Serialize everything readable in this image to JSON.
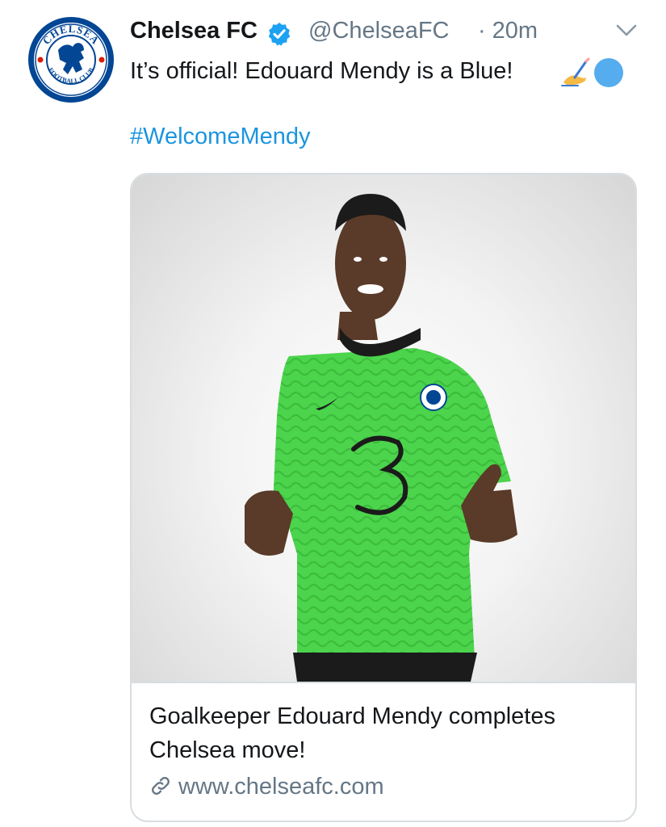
{
  "author": {
    "name": "Chelsea FC",
    "handle": "@ChelseaFC",
    "time": "20m",
    "time_separator": "·",
    "verified": true,
    "avatar_icon": "chelsea-crest-icon",
    "avatar_logo_text": "CHELSEA FOOTBALL CLUB"
  },
  "tweet": {
    "text": "It’s official! Edouard Mendy is a Blue!",
    "emojis": [
      "writing-hand-emoji",
      "blue-circle-emoji"
    ],
    "hashtag": "#WelcomeMendy"
  },
  "card": {
    "image_icon": "player-photo-image",
    "title": "Goalkeeper Edouard Mendy completes Chelsea move!",
    "link_text": "www.chelseafc.com",
    "link_icon": "link-icon"
  },
  "colors": {
    "text": "#14171a",
    "secondary": "#657786",
    "link": "#1b95e0",
    "verified": "#1da1f2",
    "jersey": "#4cd44c",
    "chelsea_blue": "#034694"
  }
}
